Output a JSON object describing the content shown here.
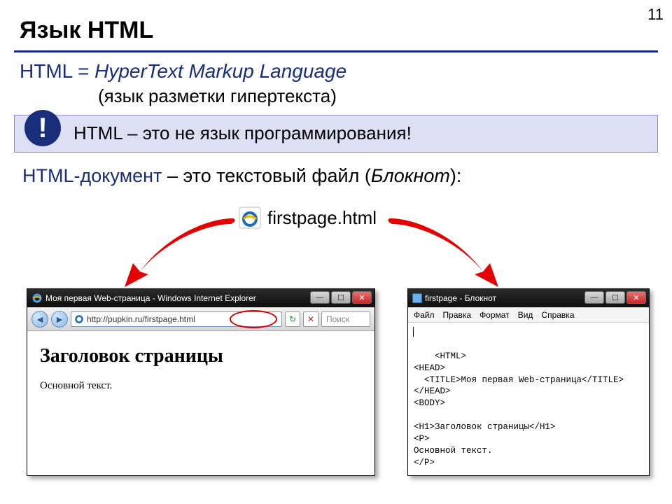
{
  "page_number": "11",
  "title": "Язык HTML",
  "def_prefix": "HTML = ",
  "def_expansion": "HyperText Markup Language",
  "def_translation": "(язык разметки гипертекста)",
  "callout_icon": "!",
  "callout_text": "HTML – это не язык программирования!",
  "doc_term": "HTML-документ",
  "doc_rest": " – это текстовый файл (",
  "doc_app": "Блокнот",
  "doc_close": "):",
  "file_name": "firstpage.html",
  "browser": {
    "title": "Моя первая Web-страница - Windows Internet Explorer",
    "address": "http://pupkin.ru/firstpage.html",
    "stop_label": "✕",
    "refresh_label": "↻",
    "search_placeholder": "Поиск",
    "page_h1": "Заголовок страницы",
    "page_p": "Основной текст."
  },
  "notepad": {
    "title": "firstpage - Блокнот",
    "menu": [
      "Файл",
      "Правка",
      "Формат",
      "Вид",
      "Справка"
    ],
    "content": "<HTML>\n<HEAD>\n  <TITLE>Моя первая Web-страница</TITLE>\n</HEAD>\n<BODY>\n\n<H1>Заголовок страницы</H1>\n<P>\nОсновной текст.\n</P>\n\n</BODY>\n</HTML>"
  }
}
